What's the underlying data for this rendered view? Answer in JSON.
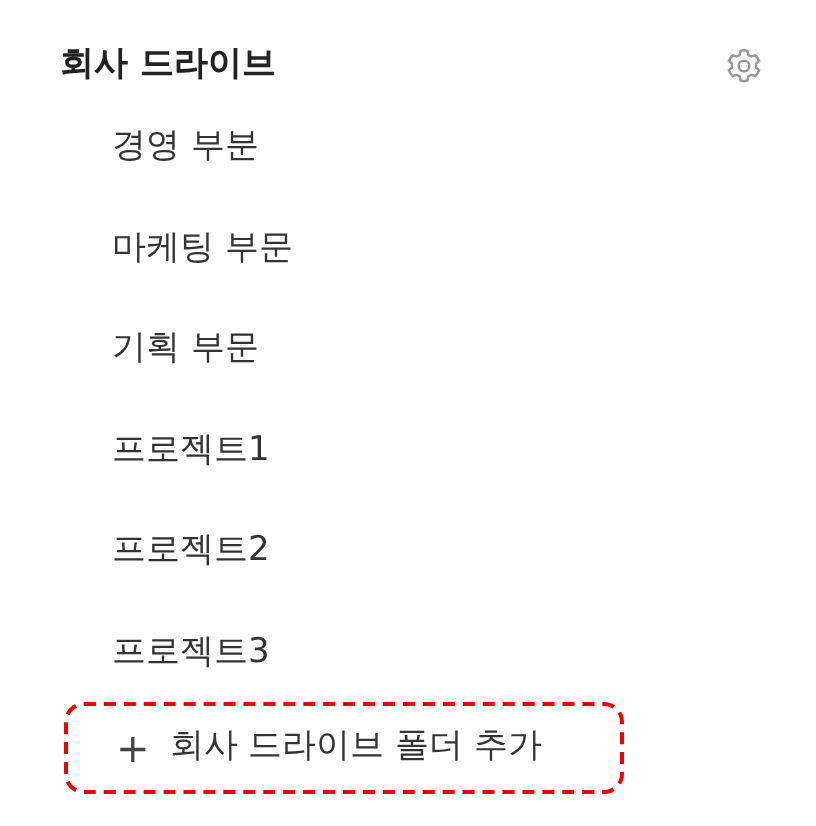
{
  "section": {
    "title": "회사 드라이브"
  },
  "folders": [
    {
      "label": "경영 부분"
    },
    {
      "label": "마케팅 부문"
    },
    {
      "label": "기획 부문"
    },
    {
      "label": "프로젝트1"
    },
    {
      "label": "프로젝트2"
    },
    {
      "label": "프로젝트3"
    }
  ],
  "add_button": {
    "icon": "+",
    "label": "회사 드라이브 폴더 추가",
    "highlighted": true
  }
}
